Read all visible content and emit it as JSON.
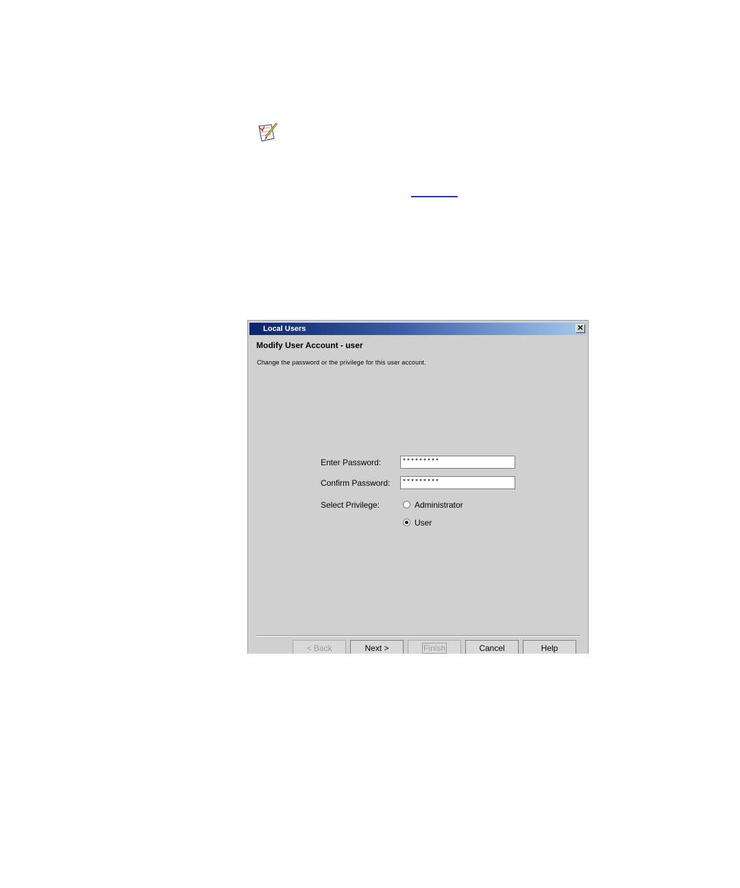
{
  "document": {
    "link_text": ""
  },
  "dialog": {
    "title": "Local Users",
    "close_glyph": "✕",
    "heading": "Modify User Account - user",
    "description": "Change the password or the privilege for this user account.",
    "form": {
      "enter_password_label": "Enter Password:",
      "enter_password_value": "*********",
      "confirm_password_label": "Confirm Password:",
      "confirm_password_value": "*********",
      "privilege_label": "Select Privilege:",
      "privilege_options": [
        {
          "label": "Administrator",
          "selected": false
        },
        {
          "label": "User",
          "selected": true
        }
      ]
    },
    "buttons": {
      "back": "< Back",
      "next": "Next >",
      "finish": "Finish",
      "cancel": "Cancel",
      "help": "Help"
    },
    "colors": {
      "title_bar_start": "#0a246a",
      "title_bar_end": "#a6caf0",
      "panel": "#d0d0d0"
    }
  },
  "icons": {
    "note": "note-pencil-icon"
  }
}
